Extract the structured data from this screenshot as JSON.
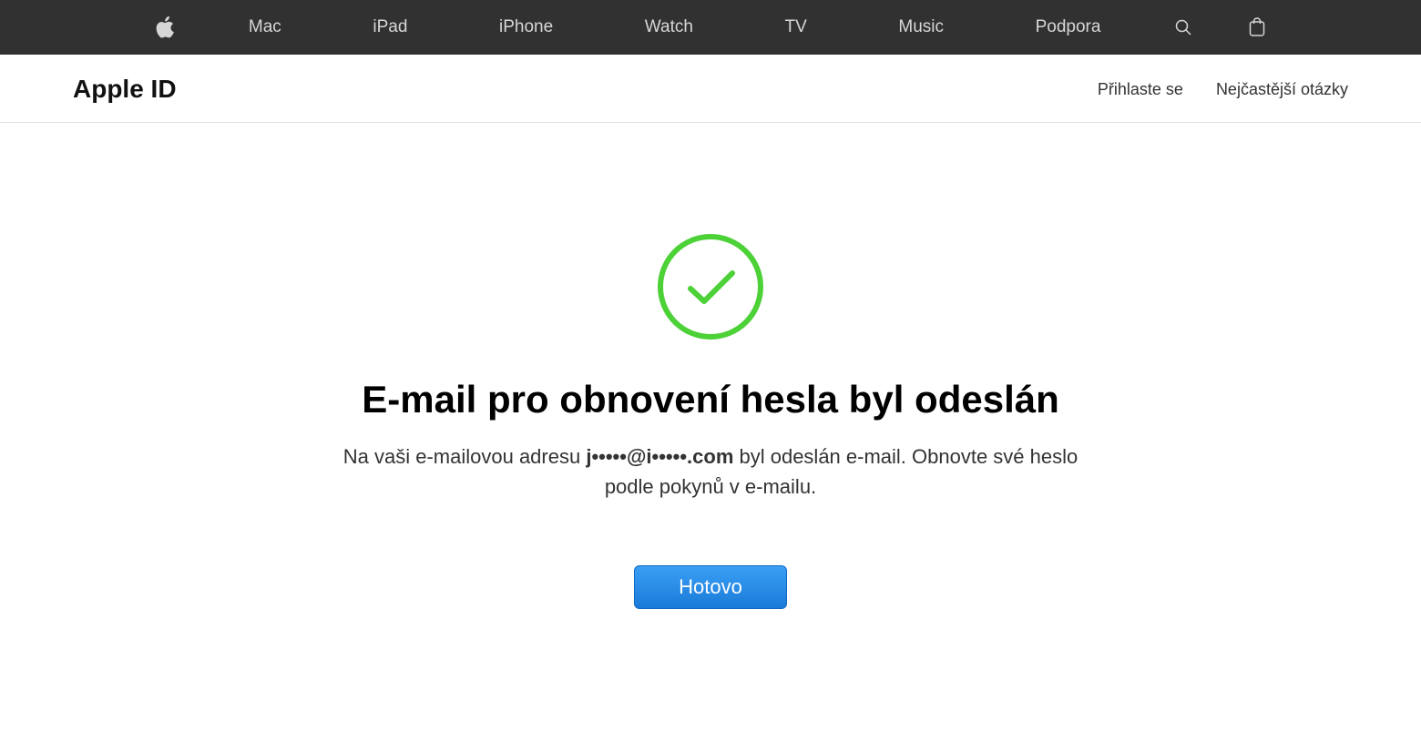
{
  "globalNav": {
    "items": [
      "Mac",
      "iPad",
      "iPhone",
      "Watch",
      "TV",
      "Music",
      "Podpora"
    ]
  },
  "subHeader": {
    "title": "Apple ID",
    "signIn": "Přihlaste se",
    "faq": "Nejčastější otázky"
  },
  "main": {
    "heading": "E-mail pro obnovení hesla byl odeslán",
    "descriptionPrefix": "Na vaši e-mailovou adresu ",
    "email": "j•••••@i•••••.com",
    "descriptionSuffix": " byl odeslán e-mail. Obnovte své heslo podle pokynů v e-mailu.",
    "doneLabel": "Hotovo"
  }
}
